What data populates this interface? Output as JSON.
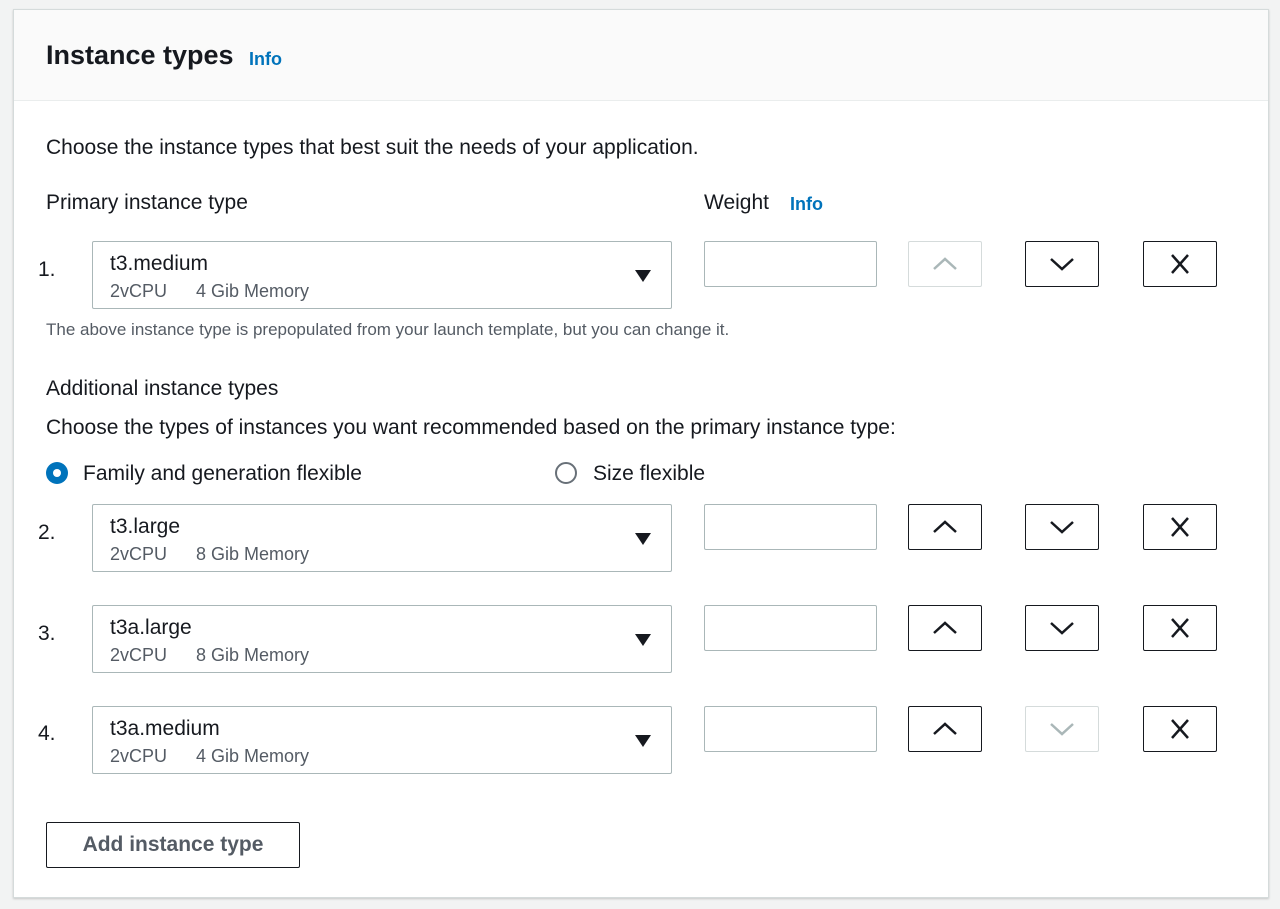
{
  "header": {
    "title": "Instance types",
    "info": "Info"
  },
  "description": "Choose the instance types that best suit the needs of your application.",
  "primary": {
    "label": "Primary instance type",
    "weight_label": "Weight",
    "weight_info": "Info",
    "row": {
      "number": "1.",
      "type": "t3.medium",
      "cpu": "2vCPU",
      "memory": "4 Gib Memory"
    },
    "hint": "The above instance type is prepopulated from your launch template, but you can change it."
  },
  "additional": {
    "label": "Additional instance types",
    "prompt": "Choose the types of instances you want recommended based on the primary instance type:",
    "options": [
      {
        "label": "Family and generation flexible",
        "selected": true
      },
      {
        "label": "Size flexible",
        "selected": false
      }
    ],
    "rows": [
      {
        "number": "2.",
        "type": "t3.large",
        "cpu": "2vCPU",
        "memory": "8 Gib Memory"
      },
      {
        "number": "3.",
        "type": "t3a.large",
        "cpu": "2vCPU",
        "memory": "8 Gib Memory"
      },
      {
        "number": "4.",
        "type": "t3a.medium",
        "cpu": "2vCPU",
        "memory": "4 Gib Memory"
      }
    ]
  },
  "add_button": "Add instance type",
  "icons": {
    "up": "chevron-up-icon",
    "down": "chevron-down-icon",
    "remove": "close-icon",
    "dropdown": "caret-down-icon"
  },
  "colors": {
    "link": "#0073bb",
    "text": "#16191f",
    "secondary": "#545b64",
    "border": "#aab7b8",
    "disabled": "#d5dbdb"
  }
}
